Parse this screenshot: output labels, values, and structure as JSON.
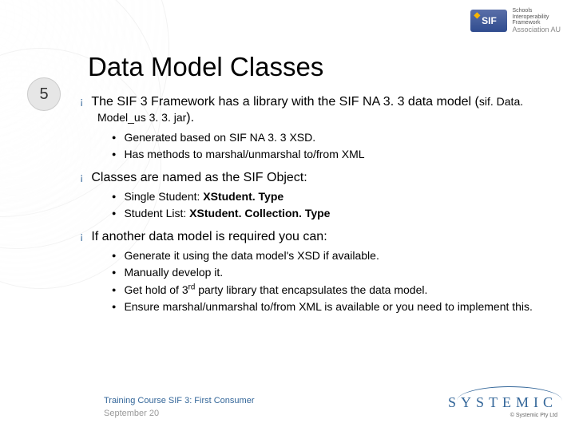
{
  "slide_number": "5",
  "logo": {
    "badge": "SIF",
    "small1": "Schools",
    "small2": "Interoperability",
    "small3": "Framework",
    "association": "Association AU"
  },
  "title": "Data Model Classes",
  "b1": {
    "text_a": "The SIF 3 Framework has a library with the SIF NA 3. 3 data model (",
    "mono": "sif. Data. Model_us 3. 3. jar",
    "text_b": ").",
    "sub": [
      "Generated based on SIF NA 3. 3 XSD.",
      "Has methods to marshal/unmarshal to/from XML"
    ]
  },
  "b2": {
    "text": "Classes are named as the SIF Object:",
    "sub": [
      {
        "pre": "Single Student: ",
        "bold": "XStudent. Type"
      },
      {
        "pre": "Student List: ",
        "bold": "XStudent. Collection. Type"
      }
    ]
  },
  "b3": {
    "text": "If another data model is required you can:",
    "sub": [
      {
        "t": "Generate it using the data model's XSD if available."
      },
      {
        "t": "Manually develop it."
      },
      {
        "html": "Get hold of 3<sup>rd</sup> party library that encapsulates the data model."
      },
      {
        "t": "Ensure marshal/unmarshal to/from XML is available or you need to implement this."
      }
    ]
  },
  "footer": {
    "line1": "Training Course SIF 3: First Consumer",
    "line2": "September 20"
  },
  "systemic": {
    "name": "SYSTEMIC",
    "copy": "© Systemic Pty Ltd"
  }
}
